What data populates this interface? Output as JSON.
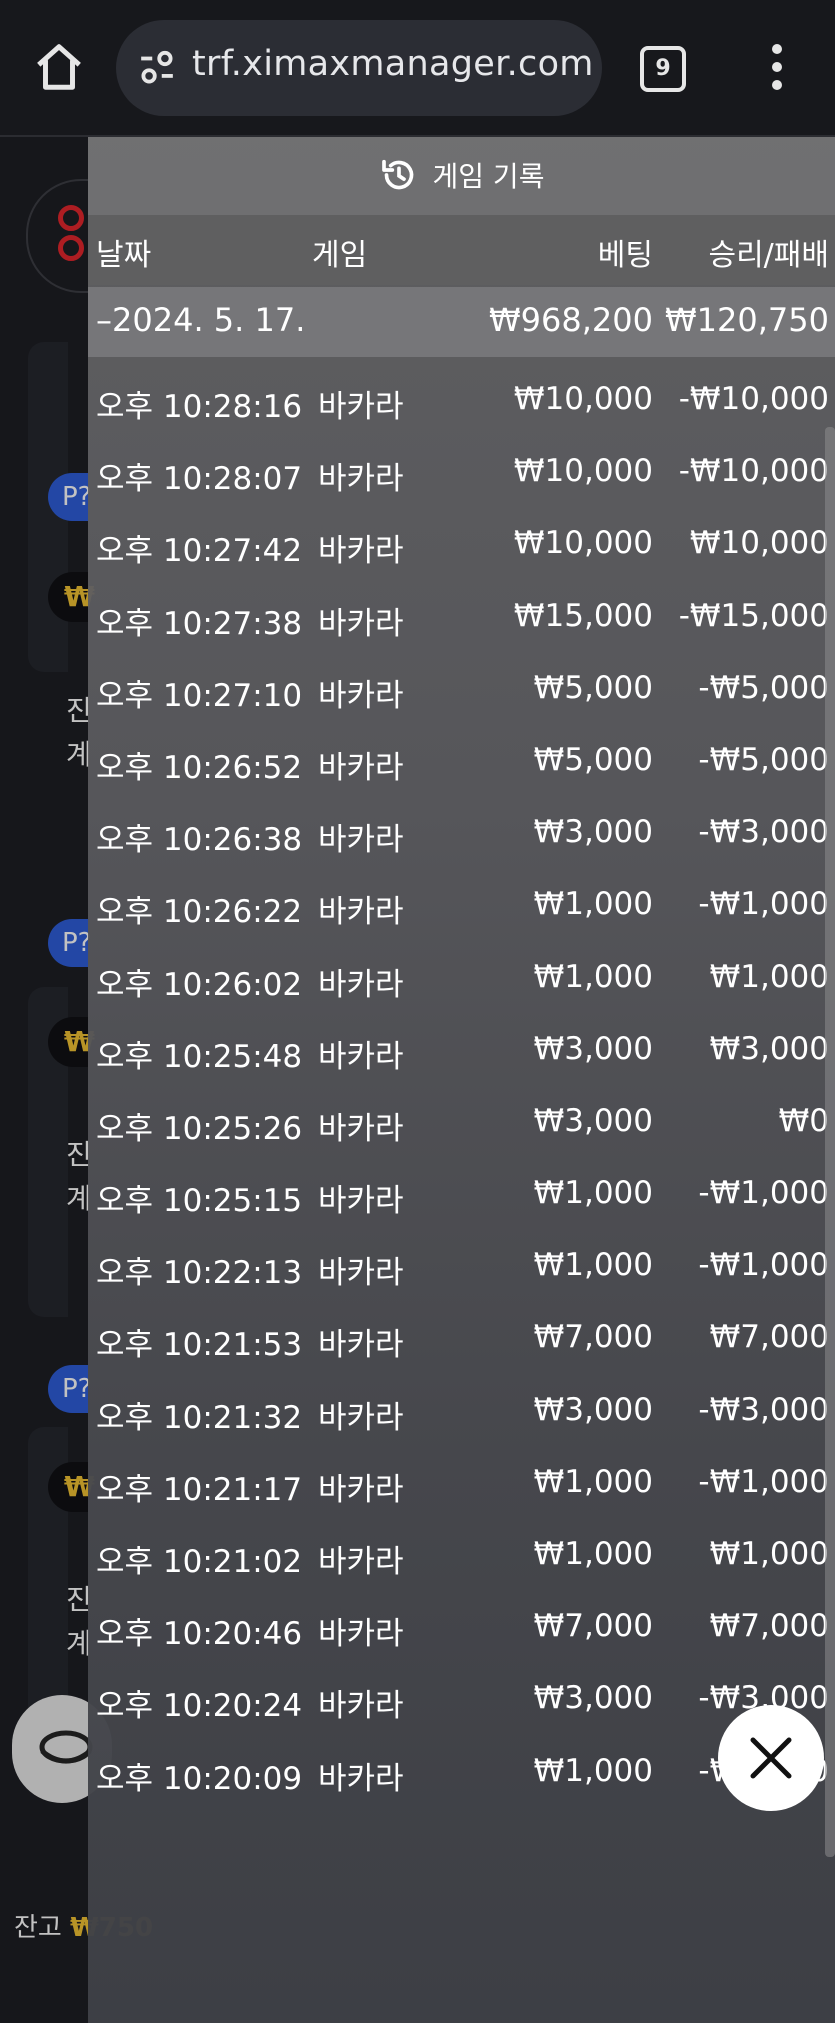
{
  "browser": {
    "url": "trf.ximaxmanager.com",
    "tab_count": "9",
    "home_icon": "home-icon",
    "site_settings_icon": "tune-icon",
    "menu_icon": "more-vert-icon"
  },
  "background_app": {
    "avatar_label": "P?",
    "coin_symbol": "₩",
    "text_line_1": "진",
    "text_line_2": "계",
    "balance_label": "잔고",
    "balance_value": "₩750"
  },
  "panel": {
    "title": "게임 기록",
    "title_icon": "history-icon",
    "columns": {
      "date": "날짜",
      "game": "게임",
      "bet": "베팅",
      "result": "승리/패배"
    },
    "date_group": {
      "label": "–2024. 5. 17.",
      "total_bet": "₩968,200",
      "total_result": "₩120,750"
    },
    "rows": [
      {
        "time": "오후 10:28:16",
        "game": "바카라",
        "bet": "₩10,000",
        "result": "-₩10,000"
      },
      {
        "time": "오후 10:28:07",
        "game": "바카라",
        "bet": "₩10,000",
        "result": "-₩10,000"
      },
      {
        "time": "오후 10:27:42",
        "game": "바카라",
        "bet": "₩10,000",
        "result": "₩10,000"
      },
      {
        "time": "오후 10:27:38",
        "game": "바카라",
        "bet": "₩15,000",
        "result": "-₩15,000"
      },
      {
        "time": "오후 10:27:10",
        "game": "바카라",
        "bet": "₩5,000",
        "result": "-₩5,000"
      },
      {
        "time": "오후 10:26:52",
        "game": "바카라",
        "bet": "₩5,000",
        "result": "-₩5,000"
      },
      {
        "time": "오후 10:26:38",
        "game": "바카라",
        "bet": "₩3,000",
        "result": "-₩3,000"
      },
      {
        "time": "오후 10:26:22",
        "game": "바카라",
        "bet": "₩1,000",
        "result": "-₩1,000"
      },
      {
        "time": "오후 10:26:02",
        "game": "바카라",
        "bet": "₩1,000",
        "result": "₩1,000"
      },
      {
        "time": "오후 10:25:48",
        "game": "바카라",
        "bet": "₩3,000",
        "result": "₩3,000"
      },
      {
        "time": "오후 10:25:26",
        "game": "바카라",
        "bet": "₩3,000",
        "result": "₩0"
      },
      {
        "time": "오후 10:25:15",
        "game": "바카라",
        "bet": "₩1,000",
        "result": "-₩1,000"
      },
      {
        "time": "오후 10:22:13",
        "game": "바카라",
        "bet": "₩1,000",
        "result": "-₩1,000"
      },
      {
        "time": "오후 10:21:53",
        "game": "바카라",
        "bet": "₩7,000",
        "result": "₩7,000"
      },
      {
        "time": "오후 10:21:32",
        "game": "바카라",
        "bet": "₩3,000",
        "result": "-₩3,000"
      },
      {
        "time": "오후 10:21:17",
        "game": "바카라",
        "bet": "₩1,000",
        "result": "-₩1,000"
      },
      {
        "time": "오후 10:21:02",
        "game": "바카라",
        "bet": "₩1,000",
        "result": "₩1,000"
      },
      {
        "time": "오후 10:20:46",
        "game": "바카라",
        "bet": "₩7,000",
        "result": "₩7,000"
      },
      {
        "time": "오후 10:20:24",
        "game": "바카라",
        "bet": "₩3,000",
        "result": "-₩3,000"
      },
      {
        "time": "오후 10:20:09",
        "game": "바카라",
        "bet": "₩1,000",
        "result": "-₩1,000"
      }
    ],
    "close_icon": "close-icon"
  }
}
